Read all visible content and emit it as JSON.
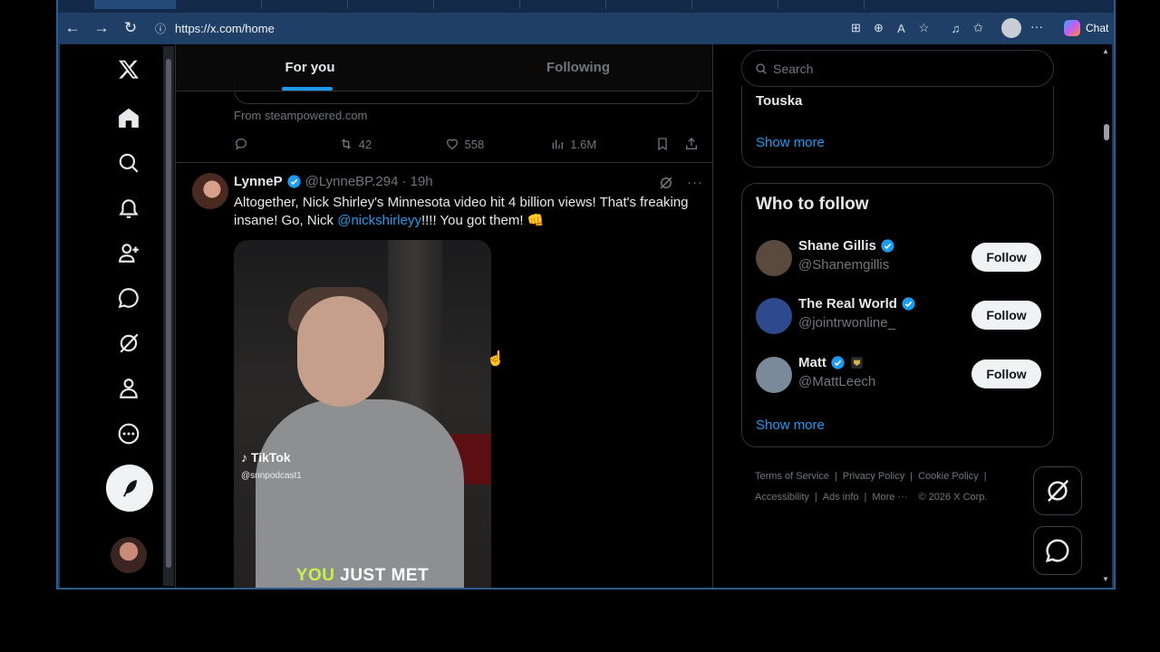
{
  "browser": {
    "url": "https://x.com/home",
    "chat_label": "Chat"
  },
  "tabs": [
    {
      "label": "For you",
      "active": true
    },
    {
      "label": "Following",
      "active": false
    }
  ],
  "previous_post": {
    "source": "From steampowered.com",
    "reposts": "42",
    "likes": "558",
    "views": "1.6M"
  },
  "post": {
    "author": "LynneP",
    "handle": "@LynneBP.294",
    "time": "· 19h",
    "text_before": "Altogether, Nick Shirley's Minnesota video hit 4 billion views! That's freaking insane! Go, Nick ",
    "mention": "@nickshirleyy",
    "text_after": "!!!! You got them! 👊",
    "media": {
      "watermark": "TikTok",
      "watermark_handle": "@snnpodcast1",
      "caption_highlight": "YOU",
      "caption_rest": " JUST MET"
    }
  },
  "sidebar": {
    "search_placeholder": "Search",
    "trend_label": "Touska",
    "trend_show_more": "Show more",
    "who_to_follow": {
      "heading": "Who to follow",
      "people": [
        {
          "name": "Shane Gillis",
          "handle": "@Shanemgillis",
          "button": "Follow",
          "avatar": "#5a4a3e"
        },
        {
          "name": "The Real World",
          "handle": "@jointrwonline_",
          "button": "Follow",
          "avatar": "#2e4a8c"
        },
        {
          "name": "Matt",
          "handle": "@MattLeech",
          "button": "Follow",
          "avatar": "#7a8a9a"
        }
      ],
      "show_more": "Show more"
    },
    "footer": {
      "terms": "Terms of Service",
      "privacy": "Privacy Policy",
      "cookie": "Cookie Policy",
      "accessibility": "Accessibility",
      "ads": "Ads info",
      "more": "More ···",
      "copyright": "© 2026 X Corp."
    }
  },
  "colors": {
    "accent": "#1d9bf0",
    "verified": "#1d9bf0",
    "background": "#000000",
    "border": "#2f3336"
  },
  "nav_icons": [
    "x-logo-icon",
    "home-icon",
    "search-icon",
    "bell-icon",
    "follow-icon",
    "chat-icon",
    "grok-icon",
    "profile-icon",
    "more-icon"
  ]
}
